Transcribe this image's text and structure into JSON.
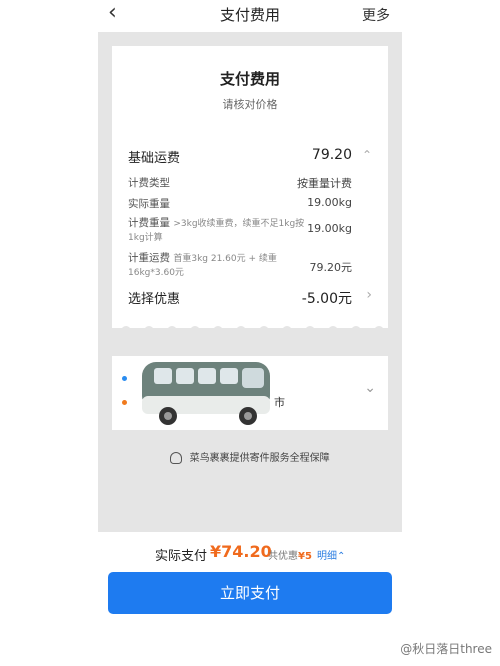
{
  "nav": {
    "back_icon": "chevron-left-icon",
    "title": "支付费用",
    "more": "更多"
  },
  "card": {
    "title": "支付费用",
    "subtitle": "请核对价格",
    "base_fee": {
      "label": "基础运费",
      "value": "79.20"
    },
    "billing_type": {
      "label": "计费类型",
      "value": "按重量计费"
    },
    "actual_weight": {
      "label": "实际重量",
      "value": "19.00kg"
    },
    "charged_weight": {
      "label": "计费重量",
      "note": ">3kg收续重费，续重不足1kg按1kg计算",
      "value": "19.00kg"
    },
    "weight_fee": {
      "label": "计重运费",
      "note": "首重3kg 21.60元 + 续重16kg*3.60元",
      "value": "79.20元"
    },
    "discount": {
      "label": "选择优惠",
      "value": "-5.00元"
    }
  },
  "address": {
    "city": "市"
  },
  "guarantee": {
    "icon": "cainiao-bird-icon",
    "text": "菜鸟裹裹提供寄件服务全程保障"
  },
  "pay": {
    "label": "实际支付",
    "amount": "¥74.20",
    "discount_prefix": "共优惠",
    "discount_amount": "¥5",
    "detail": "明细"
  },
  "pay_button": "立即支付",
  "watermark": "@秋日落日three",
  "colors": {
    "accent": "#1e7bf0",
    "price": "#f06a1d"
  }
}
